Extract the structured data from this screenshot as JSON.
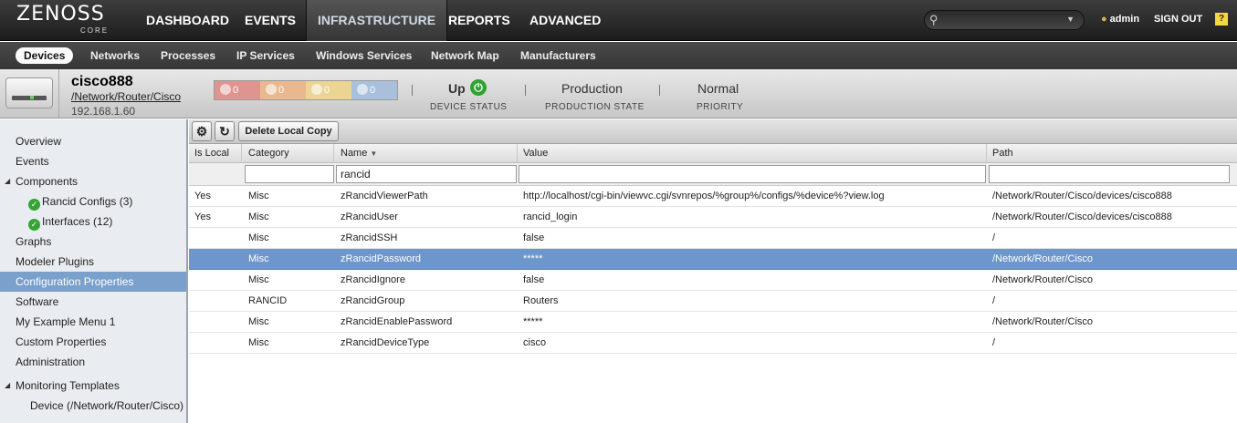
{
  "app": {
    "brand": "ZENOSS",
    "edition": "CORE"
  },
  "topnav": {
    "items": [
      "DASHBOARD",
      "EVENTS",
      "INFRASTRUCTURE",
      "REPORTS",
      "ADVANCED"
    ],
    "active": "INFRASTRUCTURE",
    "search_value": "",
    "user": "admin",
    "signout": "SIGN OUT",
    "help": "?"
  },
  "subnav": {
    "items": [
      "Devices",
      "Networks",
      "Processes",
      "IP Services",
      "Windows Services",
      "Network Map",
      "Manufacturers"
    ],
    "active": "Devices"
  },
  "device": {
    "name": "cisco888",
    "path": "/Network/Router/Cisco",
    "ip": "192.168.1.60",
    "events": [
      {
        "name": "critical",
        "count": "0",
        "color": "#e25a5a"
      },
      {
        "name": "error",
        "count": "0",
        "color": "#f08a3a"
      },
      {
        "name": "warning",
        "count": "0",
        "color": "#f1c43a"
      },
      {
        "name": "info",
        "count": "0",
        "color": "#6d97cc"
      }
    ],
    "device_status": {
      "value": "Up",
      "label": "DEVICE STATUS"
    },
    "production_state": {
      "value": "Production",
      "label": "PRODUCTION STATE"
    },
    "priority": {
      "value": "Normal",
      "label": "PRIORITY"
    }
  },
  "sidebar": {
    "items": [
      {
        "label": "Overview",
        "level": 0
      },
      {
        "label": "Events",
        "level": 0
      },
      {
        "label": "Components",
        "level": 0,
        "expanded": true
      },
      {
        "label": "Rancid Configs (3)",
        "level": 1,
        "status": "ok"
      },
      {
        "label": "Interfaces (12)",
        "level": 1,
        "status": "ok"
      },
      {
        "label": "Graphs",
        "level": 0
      },
      {
        "label": "Modeler Plugins",
        "level": 0
      },
      {
        "label": "Configuration Properties",
        "level": 0,
        "active": true
      },
      {
        "label": "Software",
        "level": 0
      },
      {
        "label": "My Example Menu 1",
        "level": 0
      },
      {
        "label": "Custom Properties",
        "level": 0
      },
      {
        "label": "Administration",
        "level": 0
      },
      {
        "label": "Monitoring Templates",
        "level": 0,
        "expanded": true
      },
      {
        "label": "Device (/Network/Router/Cisco)",
        "level": 1
      }
    ]
  },
  "toolbar": {
    "gear_icon": "gear-icon",
    "refresh_icon": "refresh-icon",
    "delete_local_copy": "Delete Local Copy"
  },
  "grid": {
    "columns": [
      "Is Local",
      "Category",
      "Name",
      "Value",
      "Path"
    ],
    "sort_column": "Name",
    "sort_direction": "descending",
    "filters": {
      "is_local": "",
      "category": "",
      "name": "rancid",
      "value": "",
      "path": ""
    },
    "rows": [
      {
        "is_local": "Yes",
        "category": "Misc",
        "name": "zRancidViewerPath",
        "value": "http://localhost/cgi-bin/viewvc.cgi/svnrepos/%group%/configs/%device%?view.log",
        "path": "/Network/Router/Cisco/devices/cisco888"
      },
      {
        "is_local": "Yes",
        "category": "Misc",
        "name": "zRancidUser",
        "value": "rancid_login",
        "path": "/Network/Router/Cisco/devices/cisco888"
      },
      {
        "is_local": "",
        "category": "Misc",
        "name": "zRancidSSH",
        "value": "false",
        "path": "/"
      },
      {
        "is_local": "",
        "category": "Misc",
        "name": "zRancidPassword",
        "value": "*****",
        "path": "/Network/Router/Cisco",
        "selected": true
      },
      {
        "is_local": "",
        "category": "Misc",
        "name": "zRancidIgnore",
        "value": "false",
        "path": "/Network/Router/Cisco"
      },
      {
        "is_local": "",
        "category": "RANCID",
        "name": "zRancidGroup",
        "value": "Routers",
        "path": "/"
      },
      {
        "is_local": "",
        "category": "Misc",
        "name": "zRancidEnablePassword",
        "value": "*****",
        "path": "/Network/Router/Cisco"
      },
      {
        "is_local": "",
        "category": "Misc",
        "name": "zRancidDeviceType",
        "value": "cisco",
        "path": "/"
      }
    ]
  }
}
